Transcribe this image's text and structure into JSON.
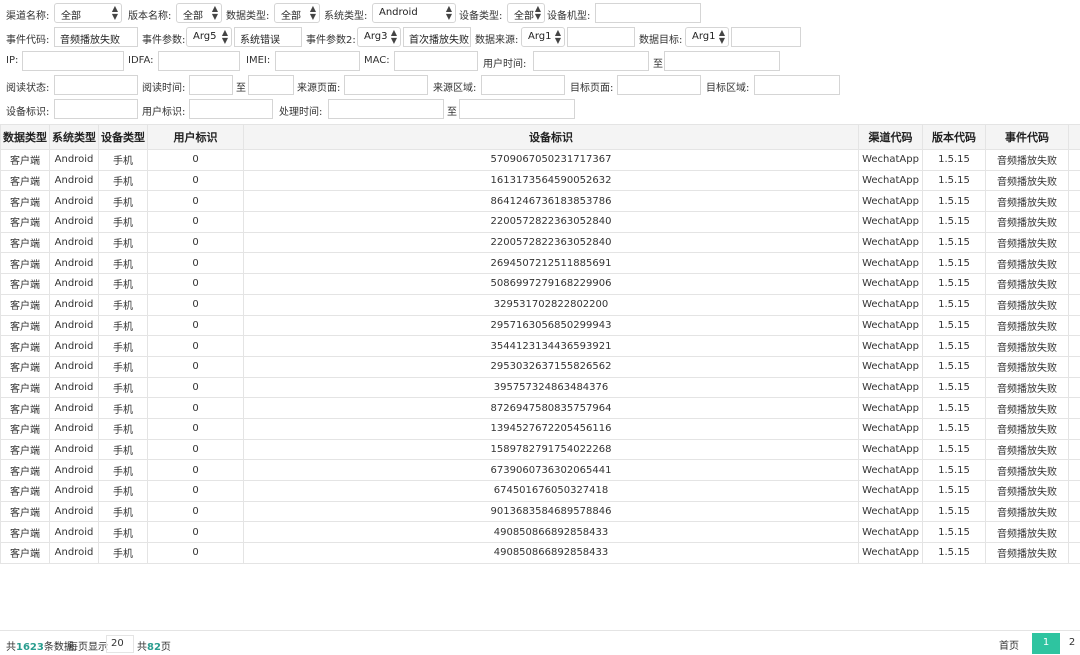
{
  "filters": {
    "channel_label": "渠道名称:",
    "channel_value": "全部",
    "version_label": "版本名称:",
    "version_value": "全部",
    "datatype_label": "数据类型:",
    "datatype_value": "全部",
    "ostype_label": "系统类型:",
    "ostype_value": "Android",
    "devtype_label": "设备类型:",
    "devtype_value": "全部",
    "devmodel_label": "设备机型:",
    "eventcode_label": "事件代码:",
    "eventcode_value": "音频播放失败",
    "eventparam_label": "事件参数:",
    "eventparam_select": "Arg5",
    "eventparam_value": "系统错误",
    "eventparam2_label": "事件参数2:",
    "eventparam2_select": "Arg3",
    "eventparam2_value": "首次播放失败",
    "datasource_label": "数据来源:",
    "datasource_select": "Arg1",
    "datatarget_label": "数据目标:",
    "datatarget_select": "Arg1",
    "ip_label": "IP:",
    "idfa_label": "IDFA:",
    "imei_label": "IMEI:",
    "mac_label": "MAC:",
    "usertime_label": "用户时间:",
    "to_label": "至",
    "readstatus_label": "阅读状态:",
    "readtime_label": "阅读时间:",
    "sourcepage_label": "来源页面:",
    "sourcearea_label": "来源区域:",
    "targetpage_label": "目标页面:",
    "targetarea_label": "目标区域:",
    "deviceid_label": "设备标识:",
    "userid_label": "用户标识:",
    "proctime_label": "处理时间:"
  },
  "table": {
    "headers": [
      "数据类型",
      "系统类型",
      "设备类型",
      "用户标识",
      "设备标识",
      "渠道代码",
      "版本代码",
      "事件代码"
    ],
    "rows": [
      [
        "客户端",
        "Android",
        "手机",
        "0",
        "5709067050231717367",
        "WechatApp",
        "1.5.15",
        "音频播放失败"
      ],
      [
        "客户端",
        "Android",
        "手机",
        "0",
        "1613173564590052632",
        "WechatApp",
        "1.5.15",
        "音频播放失败"
      ],
      [
        "客户端",
        "Android",
        "手机",
        "0",
        "8641246736183853786",
        "WechatApp",
        "1.5.15",
        "音频播放失败"
      ],
      [
        "客户端",
        "Android",
        "手机",
        "0",
        "2200572822363052840",
        "WechatApp",
        "1.5.15",
        "音频播放失败"
      ],
      [
        "客户端",
        "Android",
        "手机",
        "0",
        "2200572822363052840",
        "WechatApp",
        "1.5.15",
        "音频播放失败"
      ],
      [
        "客户端",
        "Android",
        "手机",
        "0",
        "2694507212511885691",
        "WechatApp",
        "1.5.15",
        "音频播放失败"
      ],
      [
        "客户端",
        "Android",
        "手机",
        "0",
        "5086997279168229906",
        "WechatApp",
        "1.5.15",
        "音频播放失败"
      ],
      [
        "客户端",
        "Android",
        "手机",
        "0",
        "329531702822802200",
        "WechatApp",
        "1.5.15",
        "音频播放失败"
      ],
      [
        "客户端",
        "Android",
        "手机",
        "0",
        "2957163056850299943",
        "WechatApp",
        "1.5.15",
        "音频播放失败"
      ],
      [
        "客户端",
        "Android",
        "手机",
        "0",
        "3544123134436593921",
        "WechatApp",
        "1.5.15",
        "音频播放失败"
      ],
      [
        "客户端",
        "Android",
        "手机",
        "0",
        "2953032637155826562",
        "WechatApp",
        "1.5.15",
        "音频播放失败"
      ],
      [
        "客户端",
        "Android",
        "手机",
        "0",
        "395757324863484376",
        "WechatApp",
        "1.5.15",
        "音频播放失败"
      ],
      [
        "客户端",
        "Android",
        "手机",
        "0",
        "8726947580835757964",
        "WechatApp",
        "1.5.15",
        "音频播放失败"
      ],
      [
        "客户端",
        "Android",
        "手机",
        "0",
        "1394527672205456116",
        "WechatApp",
        "1.5.15",
        "音频播放失败"
      ],
      [
        "客户端",
        "Android",
        "手机",
        "0",
        "1589782791754022268",
        "WechatApp",
        "1.5.15",
        "音频播放失败"
      ],
      [
        "客户端",
        "Android",
        "手机",
        "0",
        "6739060736302065441",
        "WechatApp",
        "1.5.15",
        "音频播放失败"
      ],
      [
        "客户端",
        "Android",
        "手机",
        "0",
        "674501676050327418",
        "WechatApp",
        "1.5.15",
        "音频播放失败"
      ],
      [
        "客户端",
        "Android",
        "手机",
        "0",
        "9013683584689578846",
        "WechatApp",
        "1.5.15",
        "音频播放失败"
      ],
      [
        "客户端",
        "Android",
        "手机",
        "0",
        "490850866892858433",
        "WechatApp",
        "1.5.15",
        "音频播放失败"
      ],
      [
        "客户端",
        "Android",
        "手机",
        "0",
        "490850866892858433",
        "WechatApp",
        "1.5.15",
        "音频播放失败"
      ]
    ]
  },
  "pager": {
    "total_prefix": "共",
    "total_count": "1623",
    "total_suffix": "条数据",
    "per_page_label": "每页显示",
    "per_page_value": "20",
    "pages_prefix": "共",
    "pages_count": "82",
    "pages_suffix": "页",
    "first_label": "首页",
    "current_page": "1",
    "next_page": "2"
  },
  "colors": {
    "accent": "#2ec4a0",
    "count_text": "#2a9d8f",
    "header_bg": "#f4f4f4",
    "border": "#e4e4e4"
  }
}
